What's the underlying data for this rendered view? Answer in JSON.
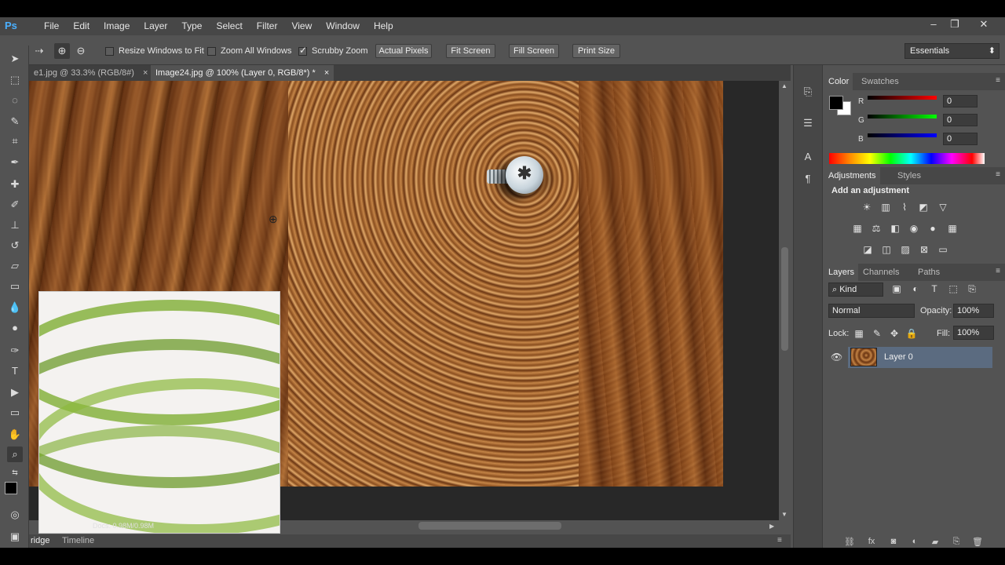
{
  "app": {
    "logo": "Ps"
  },
  "menu": [
    "File",
    "Edit",
    "Image",
    "Layer",
    "Type",
    "Select",
    "Filter",
    "View",
    "Window",
    "Help"
  ],
  "window_controls": {
    "minimize": "–",
    "restore": "❐",
    "close": "✕"
  },
  "options_bar": {
    "resize_windows_label": "Resize Windows to Fit",
    "resize_windows_checked": false,
    "zoom_all_label": "Zoom All Windows",
    "zoom_all_checked": false,
    "scrubby_zoom_label": "Scrubby Zoom",
    "scrubby_zoom_checked": true,
    "actual_pixels": "Actual Pixels",
    "fit_screen": "Fit Screen",
    "fill_screen": "Fill Screen",
    "print_size": "Print Size",
    "workspace": "Essentials"
  },
  "doc_tabs": [
    {
      "label": "e1.jpg @ 33.3% (RGB/8#)",
      "active": false
    },
    {
      "label": "Image24.jpg @ 100% (Layer 0, RGB/8*) *",
      "active": true
    }
  ],
  "bridge_overlay_text": "Docs: 0.98M/0.98M",
  "status_tabs": [
    "ridge",
    "Timeline"
  ],
  "color_panel": {
    "tabs": [
      "Color",
      "Swatches"
    ],
    "r_label": "R",
    "r_value": "0",
    "g_label": "G",
    "g_value": "0",
    "b_label": "B",
    "b_value": "0"
  },
  "adjustments_panel": {
    "tabs": [
      "Adjustments",
      "Styles"
    ],
    "heading": "Add an adjustment"
  },
  "layers_panel": {
    "tabs": [
      "Layers",
      "Channels",
      "Paths"
    ],
    "kind_label": "Kind",
    "blend_mode": "Normal",
    "opacity_label": "Opacity:",
    "opacity_value": "100%",
    "lock_label": "Lock:",
    "fill_label": "Fill:",
    "fill_value": "100%",
    "layers": [
      {
        "name": "Layer 0",
        "visible": true
      }
    ]
  }
}
